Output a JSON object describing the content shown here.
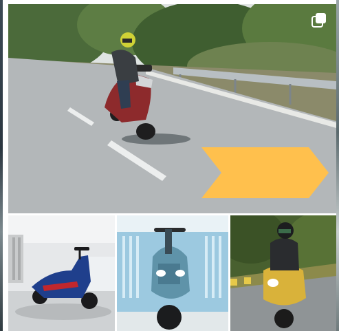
{
  "grid": {
    "main_tile": {
      "icon": "multiple-posts-icon"
    },
    "arrow": {
      "icon": "chevron-arrow-right",
      "color": "#ffc04d"
    },
    "tiles": [
      {
        "subject": "blue-scooter-showroom"
      },
      {
        "subject": "teal-scooter-headlight"
      },
      {
        "subject": "yellow-scooter-rider"
      }
    ]
  },
  "colors": {
    "road": "#b9bcbd",
    "scooter_red": "#8d2a2c",
    "scooter_blue": "#1f3f8c",
    "scooter_teal": "#5f93a9",
    "scooter_yellow": "#d9b23a"
  }
}
